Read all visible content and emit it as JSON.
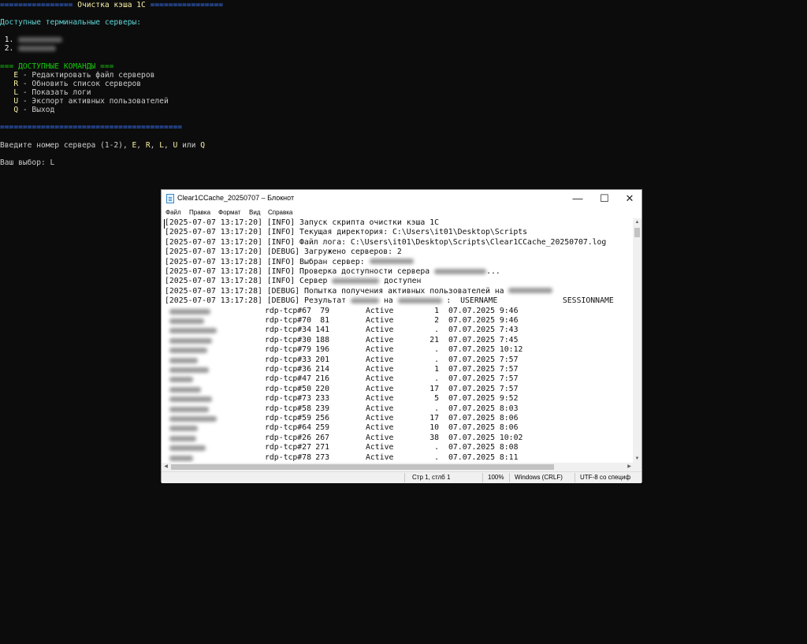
{
  "console": {
    "header_left": "================",
    "header_title": " Очистка кэша 1С ",
    "header_right": "================",
    "servers_heading": "Доступные терминальные серверы:",
    "servers": [
      {
        "num": "1."
      },
      {
        "num": "2."
      }
    ],
    "commands_heading": "=== ДОСТУПНЫЕ КОМАНДЫ ===",
    "commands": [
      {
        "key": "E",
        "text": " - Редактировать файл серверов"
      },
      {
        "key": "R",
        "text": " - Обновить список серверов"
      },
      {
        "key": "L",
        "text": " - Показать логи"
      },
      {
        "key": "U",
        "text": " - Экспорт активных пользователей"
      },
      {
        "key": "Q",
        "text": " - Выход"
      }
    ],
    "separator": "========================================",
    "prompt_prefix": "Введите номер сервера (1-2), ",
    "prompt_e": "E",
    "prompt_r": "R",
    "prompt_l": "L",
    "prompt_u": "U",
    "prompt_or": "или",
    "prompt_q": "Q",
    "choice_label": "Ваш выбор: ",
    "choice_value": "L"
  },
  "notepad": {
    "title": "Clear1CCache_20250707 – Блокнот",
    "controls": {
      "minimize": "—",
      "maximize": "☐",
      "close": "✕"
    },
    "menu": [
      "Файл",
      "Правка",
      "Формат",
      "Вид",
      "Справка"
    ],
    "log_lines": [
      "[2025-07-07 13:17:20] [INFO] Запуск скрипта очистки кэша 1С",
      "[2025-07-07 13:17:20] [INFO] Текущая директория: C:\\Users\\it01\\Desktop\\Scripts",
      "[2025-07-07 13:17:20] [INFO] Файл лога: C:\\Users\\it01\\Desktop\\Scripts\\Clear1CCache_20250707.log",
      "[2025-07-07 13:17:20] [DEBUG] Загружено серверов: 2",
      "[2025-07-07 13:17:28] [INFO] Выбран сервер:",
      "[2025-07-07 13:17:28] [INFO] Проверка доступности сервера",
      "[2025-07-07 13:17:28] [INFO] Сервер",
      "[2025-07-07 13:17:28] [DEBUG] Попытка получения активных пользователей на",
      "[2025-07-07 13:17:28] [DEBUG] Результат"
    ],
    "line6_suffix": "...",
    "line7_suffix": " доступен",
    "line9_mid": " на ",
    "line9_suffix": " :  USERNAME              SESSIONNAME        ID",
    "sessions": [
      {
        "session": "rdp-tcp#67",
        "id": "79",
        "state": "Active",
        "idle": "1",
        "logon": "07.07.2025 9:46"
      },
      {
        "session": "rdp-tcp#70",
        "id": "81",
        "state": "Active",
        "idle": "2",
        "logon": "07.07.2025 9:46"
      },
      {
        "session": "rdp-tcp#34",
        "id": "141",
        "state": "Active",
        "idle": ".",
        "logon": "07.07.2025 7:43"
      },
      {
        "session": "rdp-tcp#30",
        "id": "188",
        "state": "Active",
        "idle": "21",
        "logon": "07.07.2025 7:45"
      },
      {
        "session": "rdp-tcp#79",
        "id": "196",
        "state": "Active",
        "idle": ".",
        "logon": "07.07.2025 10:12"
      },
      {
        "session": "rdp-tcp#33",
        "id": "201",
        "state": "Active",
        "idle": ".",
        "logon": "07.07.2025 7:57"
      },
      {
        "session": "rdp-tcp#36",
        "id": "214",
        "state": "Active",
        "idle": "1",
        "logon": "07.07.2025 7:57"
      },
      {
        "session": "rdp-tcp#47",
        "id": "216",
        "state": "Active",
        "idle": ".",
        "logon": "07.07.2025 7:57"
      },
      {
        "session": "rdp-tcp#50",
        "id": "220",
        "state": "Active",
        "idle": "17",
        "logon": "07.07.2025 7:57"
      },
      {
        "session": "rdp-tcp#73",
        "id": "233",
        "state": "Active",
        "idle": "5",
        "logon": "07.07.2025 9:52"
      },
      {
        "session": "rdp-tcp#58",
        "id": "239",
        "state": "Active",
        "idle": ".",
        "logon": "07.07.2025 8:03"
      },
      {
        "session": "rdp-tcp#59",
        "id": "256",
        "state": "Active",
        "idle": "17",
        "logon": "07.07.2025 8:06"
      },
      {
        "session": "rdp-tcp#64",
        "id": "259",
        "state": "Active",
        "idle": "10",
        "logon": "07.07.2025 8:06"
      },
      {
        "session": "rdp-tcp#26",
        "id": "267",
        "state": "Active",
        "idle": "38",
        "logon": "07.07.2025 10:02"
      },
      {
        "session": "rdp-tcp#27",
        "id": "271",
        "state": "Active",
        "idle": ".",
        "logon": "07.07.2025 8:08"
      },
      {
        "session": "rdp-tcp#78",
        "id": "273",
        "state": "Active",
        "idle": ".",
        "logon": "07.07.2025 8:11"
      }
    ],
    "status": {
      "position": "Стр 1, стлб 1",
      "zoom": "100%",
      "line_endings": "Windows (CRLF)",
      "encoding": "UTF-8 со специф"
    }
  }
}
